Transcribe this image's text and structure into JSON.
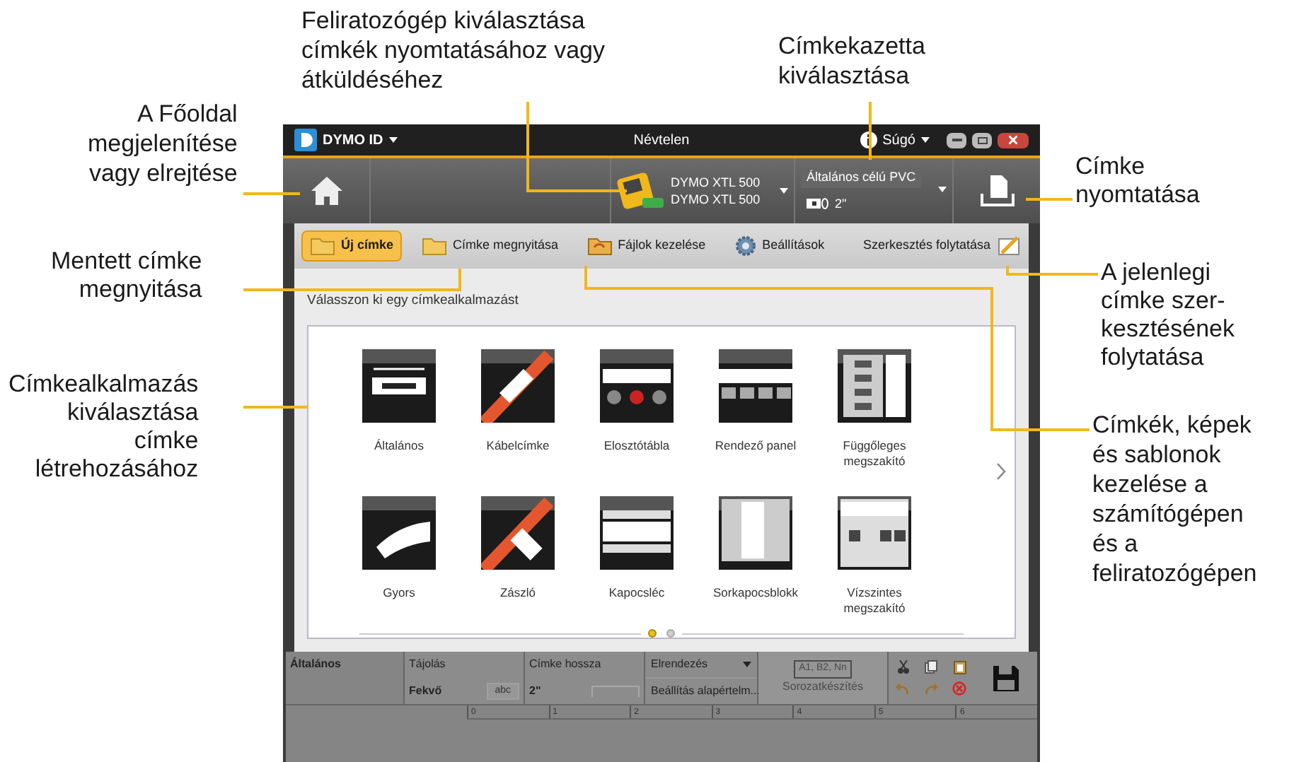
{
  "annotations": [
    {
      "lines": [
        "Feliratozógép kiválasztása",
        "címkék nyomtatásához vagy",
        "átküldéséhez"
      ]
    },
    {
      "lines": [
        "Címkekazetta",
        "kiválasztása"
      ]
    },
    {
      "lines": [
        "A Főoldal",
        "megjelenítése",
        "vagy elrejtése"
      ]
    },
    {
      "lines": [
        "Mentett címke",
        "megnyitása"
      ]
    },
    {
      "lines": [
        "Címkealkalmazás",
        "kiválasztása",
        "címke",
        "létrehozásához"
      ]
    },
    {
      "lines": [
        "Címke",
        "nyomtatása"
      ]
    },
    {
      "lines": [
        "A jelenlegi",
        "címke szer-",
        "kesztésének",
        "folytatása"
      ]
    },
    {
      "lines": [
        "Címkék, képek",
        "és sablonok",
        "kezelése a",
        "számítógépen",
        "és a",
        "feliratozógépen"
      ]
    }
  ],
  "title_bar": {
    "app": "DYMO ID",
    "document": "Névtelen",
    "help": "Súgó"
  },
  "toolbar": {
    "printer": {
      "name": "DYMO XTL 500",
      "model": "DYMO XTL 500"
    },
    "cassette": {
      "type": "Általános célú",
      "material": "PVC",
      "width": "2\""
    }
  },
  "nav": {
    "items": [
      {
        "label": "Új címke",
        "selected": true
      },
      {
        "label": "Címke megnyitása",
        "selected": false
      },
      {
        "label": "Fájlok kezelése",
        "selected": false
      },
      {
        "label": "Beállítások",
        "selected": false
      }
    ],
    "continue": "Szerkesztés folytatása"
  },
  "section_title": "Válasszon ki egy címkealkalmazást",
  "tiles": [
    {
      "label": "Általános",
      "kind": "general"
    },
    {
      "label": "Kábelcímke",
      "kind": "cable"
    },
    {
      "label": "Elosztótábla",
      "kind": "patch"
    },
    {
      "label": "Rendező panel",
      "kind": "panel"
    },
    {
      "label": "Függőleges megszakító",
      "kind": "breaker_v"
    },
    {
      "label": "Gyors",
      "kind": "quick"
    },
    {
      "label": "Zászló",
      "kind": "flag"
    },
    {
      "label": "Kapocsléc",
      "kind": "punch"
    },
    {
      "label": "Sorkapocsblokk",
      "kind": "terminal"
    },
    {
      "label": "Vízszintes megszakító",
      "kind": "breaker_h"
    }
  ],
  "pages": [
    {
      "selected": true
    },
    {
      "selected": false
    }
  ],
  "properties": {
    "section": "Általános",
    "orientation_label": "Tájolás",
    "orientation_value": "Fekvő",
    "orientation_sample": "abc",
    "length_label": "Címke hossza",
    "length_value": "2\"",
    "layout_label": "Elrendezés",
    "reset": "Beállítás alapértelm...",
    "serial_sample": "A1, B2, Nn",
    "serial_label": "Sorozatkészítés",
    "serial_disabled": true
  },
  "ruler": [
    "0",
    "1",
    "2",
    "3",
    "4",
    "5",
    "6"
  ]
}
